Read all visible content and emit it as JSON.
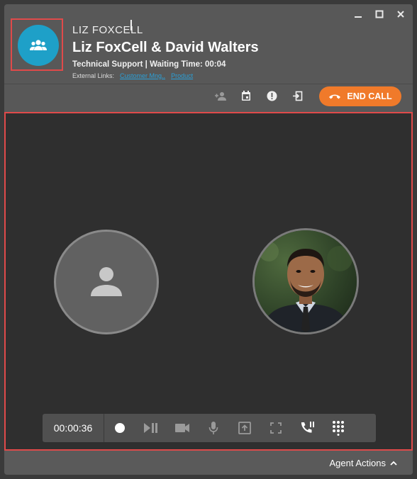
{
  "window": {
    "controls": [
      "minimize",
      "maximize",
      "close"
    ]
  },
  "header": {
    "caller_name": "LIZ FOXCELL",
    "call_title": "Liz FoxCell & David Walters",
    "meta": "Technical Support | Waiting Time: 00:04",
    "external_links_label": "External Links:",
    "links": [
      "Customer Mng..",
      "Product"
    ]
  },
  "toolbar": {
    "icons": [
      "add-person-icon",
      "calendar-icon",
      "alert-icon",
      "transfer-icon"
    ],
    "end_call_label": "END CALL"
  },
  "call_controls": {
    "timer": "00:00:36",
    "buttons": [
      "record-icon",
      "play-pause-icon",
      "video-icon",
      "mic-icon",
      "share-screen-icon",
      "fullscreen-icon",
      "call-hold-icon",
      "dialpad-icon"
    ]
  },
  "footer": {
    "agent_actions_label": "Agent Actions"
  },
  "colors": {
    "accent_blue": "#1ea0c8",
    "end_call_orange": "#f07a2a",
    "highlight_red": "#e04a4a",
    "link_blue": "#2aa0d8"
  }
}
